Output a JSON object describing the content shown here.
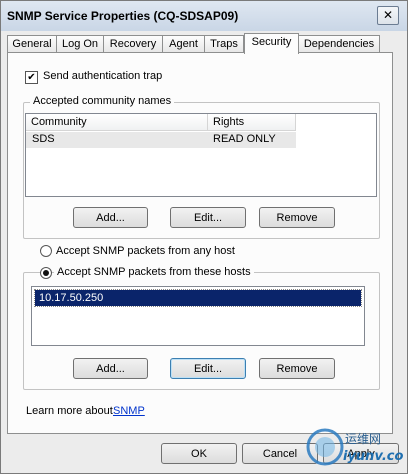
{
  "window": {
    "title": "SNMP Service Properties (CQ-SDSAP09)",
    "close_glyph": "✕"
  },
  "tabs": [
    {
      "label": "General"
    },
    {
      "label": "Log On"
    },
    {
      "label": "Recovery"
    },
    {
      "label": "Agent"
    },
    {
      "label": "Traps"
    },
    {
      "label": "Security"
    },
    {
      "label": "Dependencies"
    }
  ],
  "active_tab": "Security",
  "auth_trap": {
    "label": "Send authentication trap",
    "checked": true,
    "check_glyph": "✔"
  },
  "communities": {
    "group_label": "Accepted community names",
    "columns": [
      "Community",
      "Rights"
    ],
    "rows": [
      {
        "community": "SDS",
        "rights": "READ ONLY"
      }
    ],
    "buttons": {
      "add": "Add...",
      "edit": "Edit...",
      "remove": "Remove"
    }
  },
  "accept_any": {
    "label": "Accept SNMP packets from any host",
    "selected": false
  },
  "accept_these": {
    "label": "Accept SNMP packets from these hosts",
    "selected": true,
    "hosts": [
      "10.17.50.250"
    ],
    "buttons": {
      "add": "Add...",
      "edit": "Edit...",
      "remove": "Remove"
    }
  },
  "learn_more": {
    "prefix": "Learn more about",
    "link": "SNMP"
  },
  "footer": {
    "ok": "OK",
    "cancel": "Cancel",
    "apply": "Apply"
  },
  "watermark": {
    "text1": "运维网",
    "text2": "iyunv.com"
  }
}
